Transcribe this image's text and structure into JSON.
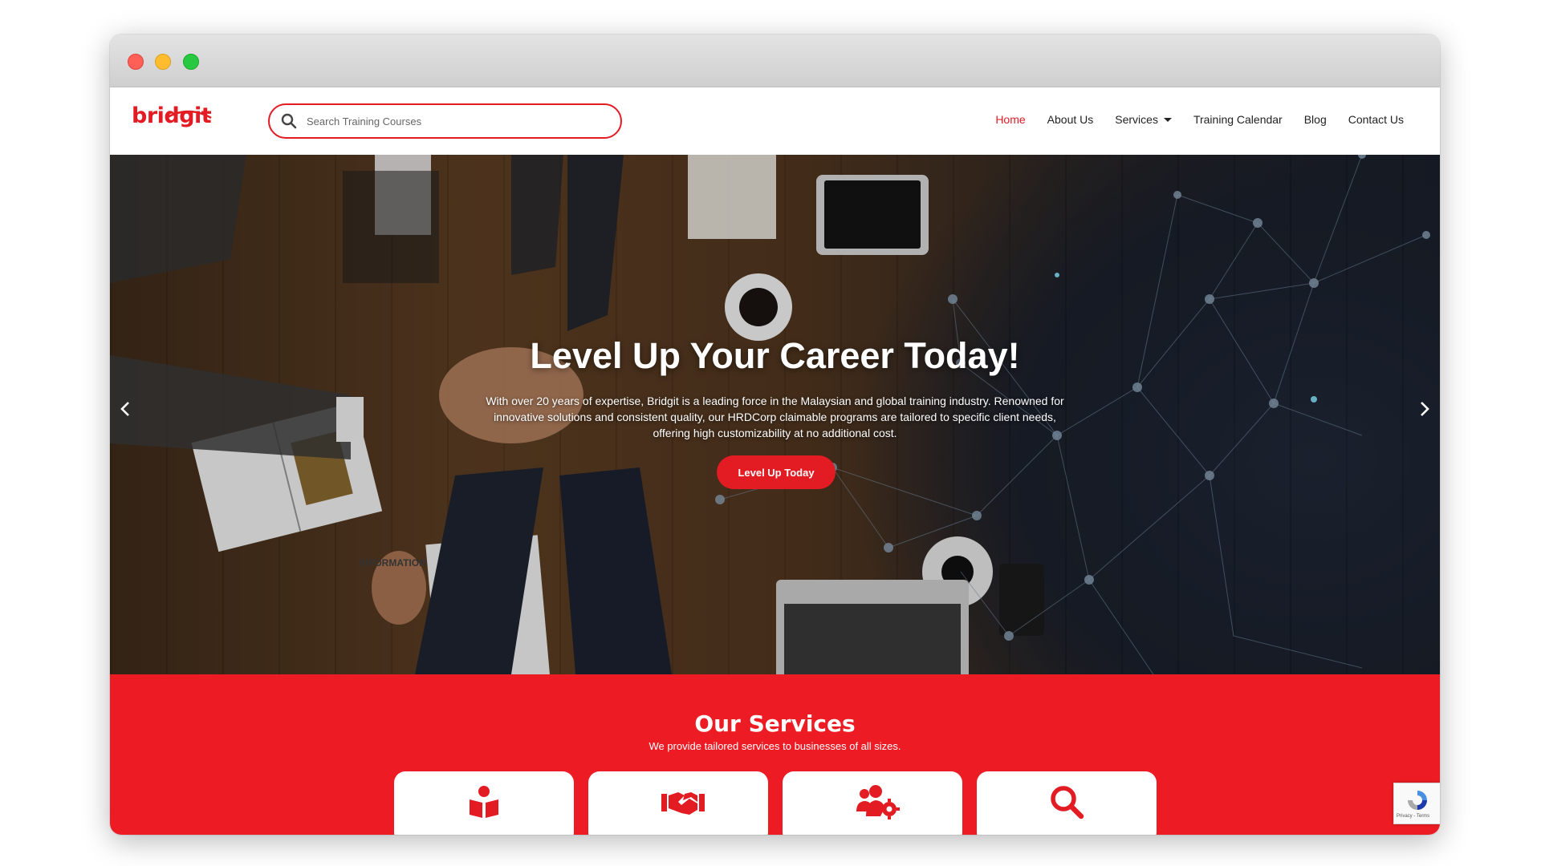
{
  "window": {
    "controls": [
      "close",
      "minimize",
      "maximize"
    ]
  },
  "header": {
    "logo": "bridgit",
    "search": {
      "placeholder": "Search Training Courses",
      "value": ""
    },
    "nav": [
      {
        "label": "Home",
        "active": true
      },
      {
        "label": "About Us"
      },
      {
        "label": "Services",
        "dropdown": true
      },
      {
        "label": "Training Calendar"
      },
      {
        "label": "Blog"
      },
      {
        "label": "Contact Us"
      }
    ]
  },
  "hero": {
    "title": "Level Up Your Career Today!",
    "text": "With over 20 years of expertise, Bridgit is a leading force in the Malaysian and global training industry. Renowned for innovative solutions and consistent quality, our HRDCorp claimable programs are tailored to specific client needs, offering high customizability at no additional cost.",
    "cta": "Level Up Today",
    "image_text": "INFORMATION"
  },
  "services": {
    "title": "Our Services",
    "subtitle": "We provide tailored services to businesses of all sizes.",
    "cards": [
      {
        "icon": "book-reader-icon"
      },
      {
        "icon": "handshake-icon"
      },
      {
        "icon": "users-gear-icon"
      },
      {
        "icon": "search-icon"
      }
    ]
  },
  "recaptcha": {
    "label": "Privacy - Terms"
  },
  "colors": {
    "brand": "#e31b23",
    "services_bg": "#ed1c24"
  }
}
